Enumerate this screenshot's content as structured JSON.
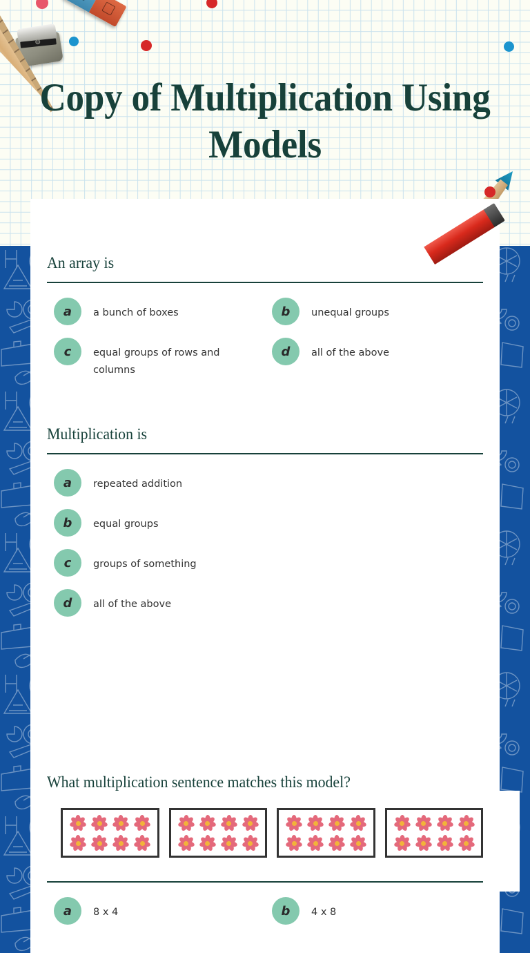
{
  "worksheet": {
    "title": "Copy of Multiplication Using Models",
    "theme": {
      "header_bg": "#FCFDF4",
      "grid_line": "#C9E2EE",
      "title_color": "#17413A",
      "panel_blue": "#13529F",
      "bubble_green": "#84C9AE",
      "card_white": "#FFFFFF",
      "text_color": "#333333",
      "flower_petal": "#E4697B",
      "flower_core": "#F2B33A"
    },
    "decorations": [
      {
        "name": "pencil-sharpener-icon"
      },
      {
        "name": "eraser-icon"
      },
      {
        "name": "wooden-ruler-icon"
      },
      {
        "name": "blue-pencil-icon"
      },
      {
        "name": "red-pencil-icon"
      },
      {
        "name": "confetti-dot-pink"
      },
      {
        "name": "confetti-dot-blue"
      },
      {
        "name": "confetti-dot-red"
      }
    ]
  },
  "questions": [
    {
      "id": "q1",
      "prompt": "An array is",
      "columns": 2,
      "options": [
        {
          "letter": "a",
          "text": "a bunch of boxes"
        },
        {
          "letter": "b",
          "text": "unequal groups"
        },
        {
          "letter": "c",
          "text": "equal groups of rows and columns"
        },
        {
          "letter": "d",
          "text": "all of the above"
        }
      ]
    },
    {
      "id": "q2",
      "prompt": "Multiplication is",
      "columns": 1,
      "options": [
        {
          "letter": "a",
          "text": "repeated addition"
        },
        {
          "letter": "b",
          "text": "equal groups"
        },
        {
          "letter": "c",
          "text": "groups of something"
        },
        {
          "letter": "d",
          "text": "all of the above"
        }
      ]
    },
    {
      "id": "q3",
      "prompt": "What multiplication sentence matches this model?",
      "columns": 2,
      "model": {
        "type": "flower-array",
        "group_count": 4,
        "rows_per_group": 2,
        "columns_per_group": 4,
        "flowers_per_group": 8,
        "total_flowers": 32
      },
      "options": [
        {
          "letter": "a",
          "text": "8 x 4"
        },
        {
          "letter": "b",
          "text": "4 x 8"
        }
      ]
    }
  ]
}
